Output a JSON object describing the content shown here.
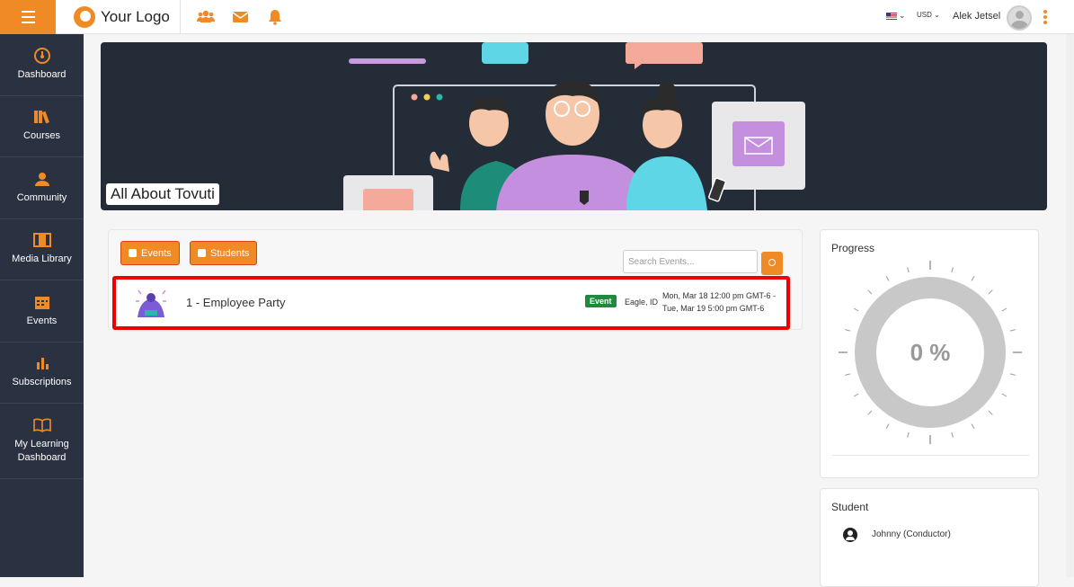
{
  "header": {
    "logo_text": "Your Logo",
    "icons": [
      "users-icon",
      "envelope-icon",
      "bell-icon"
    ],
    "language": "",
    "currency": "USD",
    "username": "Alek Jetsel",
    "accent": "#f08a24"
  },
  "sidebar": {
    "items": [
      {
        "label": "Dashboard",
        "icon": "dashboard-icon"
      },
      {
        "label": "Courses",
        "icon": "books-icon"
      },
      {
        "label": "Community",
        "icon": "community-icon"
      },
      {
        "label": "Media Library",
        "icon": "film-icon"
      },
      {
        "label": "Events",
        "icon": "calendar-icon"
      },
      {
        "label": "Subscriptions",
        "icon": "bar-chart-icon"
      },
      {
        "label": "My Learning Dashboard",
        "icon": "open-book-icon"
      }
    ],
    "bg": "#2a3140"
  },
  "banner": {
    "title": "All About Tovuti"
  },
  "tabs": {
    "events_label": "Events",
    "students_label": "Students"
  },
  "search": {
    "placeholder": "Search Events..."
  },
  "events": [
    {
      "title": "1 - Employee Party",
      "badge": "Event",
      "location": "Eagle, ID",
      "date_line1": "Mon, Mar 18 12:00 pm GMT-6 -",
      "date_line2": "Tue, Mar 19 5:00 pm GMT-6",
      "badge_color": "#1e8a3e"
    }
  ],
  "progress": {
    "title": "Progress",
    "value_text": "0 %",
    "value": 0
  },
  "student": {
    "title": "Student",
    "name": "Johnny (Conductor)"
  }
}
